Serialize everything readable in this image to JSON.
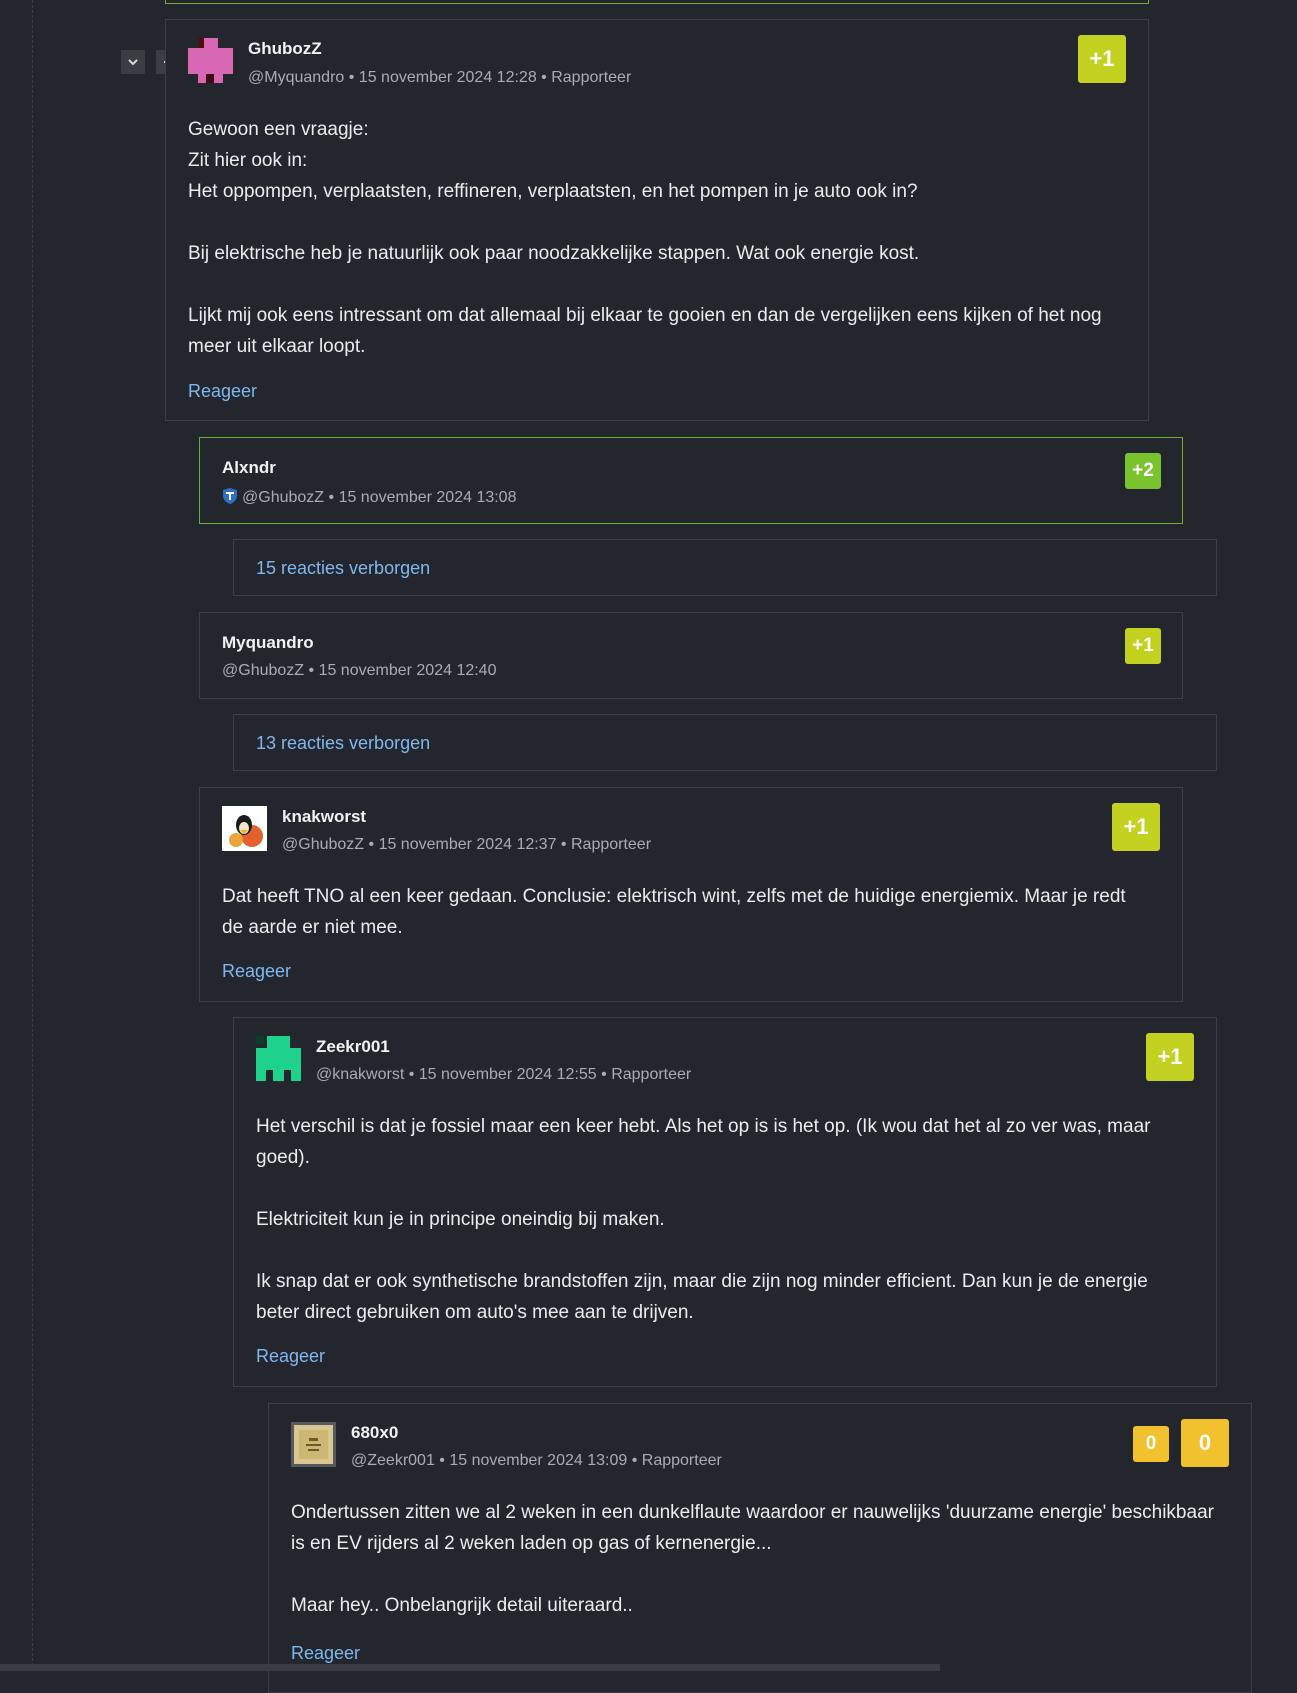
{
  "controls": {
    "collapse_icon": "chevron-down-icon",
    "minimize_icon": "minus-icon"
  },
  "comments": [
    {
      "author": "GhubozZ",
      "reply_to": "@Myquandro",
      "date": "15 november 2024 12:28",
      "report": "Rapporteer",
      "score": "+1",
      "body": [
        "Gewoon een vraagje:",
        "Zit hier ook in:",
        "Het oppompen, verplaatsten, reffineren, verplaatsten, en het pompen in je auto ook in?",
        "Bij elektrische heb je natuurlijk ook paar noodzakkelijke stappen. Wat ook energie kost.",
        "Lijkt mij ook eens intressant om dat allemaal bij elkaar te gooien en dan de vergelijken eens kijken of het nog meer uit elkaar loopt."
      ],
      "reply": "Reageer"
    },
    {
      "author": "Alxndr",
      "reply_to": "@GhubozZ",
      "date": "15 november 2024 13:08",
      "score": "+2",
      "badge_icon": "shield-icon"
    },
    {
      "author": "Myquandro",
      "reply_to": "@GhubozZ",
      "date": "15 november 2024 12:40",
      "score": "+1"
    },
    {
      "author": "knakworst",
      "reply_to": "@GhubozZ",
      "date": "15 november 2024 12:37",
      "report": "Rapporteer",
      "score": "+1",
      "body": [
        "Dat heeft TNO al een keer gedaan. Conclusie: elektrisch wint, zelfs met de huidige energiemix. Maar je redt de aarde er niet mee."
      ],
      "reply": "Reageer"
    },
    {
      "author": "Zeekr001",
      "reply_to": "@knakworst",
      "date": "15 november 2024 12:55",
      "report": "Rapporteer",
      "score": "+1",
      "body": [
        "Het verschil is dat je fossiel maar een keer hebt. Als het op is is het op. (Ik wou dat het al zo ver was, maar goed).",
        "Elektriciteit kun je in principe oneindig bij maken.",
        "Ik snap dat er ook synthetische brandstoffen zijn, maar die zijn nog minder efficient. Dan kun je de energie beter direct gebruiken om auto's mee aan te drijven."
      ],
      "reply": "Reageer"
    },
    {
      "author": "680x0",
      "reply_to": "@Zeekr001",
      "date": "15 november 2024 13:09",
      "report": "Rapporteer",
      "score": "0",
      "score_alt": "0",
      "body": [
        "Ondertussen zitten we al 2 weken in een dunkelflaute waardoor er nauwelijks 'duurzame energie' beschikbaar is en EV rijders al 2 weken laden op gas of kernenergie...",
        "Maar hey.. Onbelangrijk detail uiteraard.."
      ],
      "reply": "Reageer"
    }
  ],
  "hidden": [
    {
      "label": "15 reacties verborgen"
    },
    {
      "label": "13 reacties verborgen"
    }
  ],
  "colors": {
    "background": "#23262c",
    "border": "#3b3f46",
    "highlight_border": "#6fae2c",
    "link": "#7fb8f0",
    "score_lime": "#c3d221",
    "score_green": "#79c32d",
    "score_yellow": "#f2c12e"
  }
}
